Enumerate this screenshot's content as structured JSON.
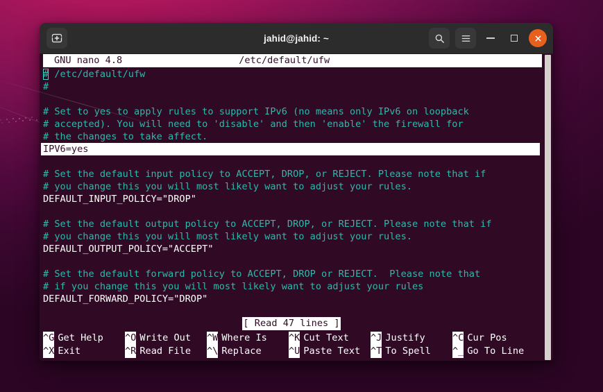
{
  "window": {
    "title": "jahid@jahid: ~",
    "new_tab_icon": "new-terminal-icon",
    "search_icon": "search-icon",
    "menu_icon": "hamburger-menu-icon",
    "minimize_label": "—",
    "maximize_label": "□",
    "close_label": "✕",
    "accent_close_color": "#e8601d",
    "titlebar_color": "#2c2c2c"
  },
  "terminal": {
    "background_color": "#300a24",
    "foreground_color": "#ffffff",
    "comment_color": "#2fb8ab"
  },
  "nano": {
    "version": "GNU nano 4.8",
    "filename": "/etc/default/ufw",
    "status_message": "[ Read 47 lines ]",
    "lines": [
      {
        "type": "comment-cursor",
        "cursor": "#",
        "rest": " /etc/default/ufw"
      },
      {
        "type": "comment",
        "text": "#"
      },
      {
        "type": "blank",
        "text": ""
      },
      {
        "type": "comment",
        "text": "# Set to yes to apply rules to support IPv6 (no means only IPv6 on loopback"
      },
      {
        "type": "comment",
        "text": "# accepted). You will need to 'disable' and then 'enable' the firewall for"
      },
      {
        "type": "comment",
        "text": "# the changes to take affect."
      },
      {
        "type": "selected",
        "text": "IPV6=yes"
      },
      {
        "type": "blank",
        "text": ""
      },
      {
        "type": "comment",
        "text": "# Set the default input policy to ACCEPT, DROP, or REJECT. Please note that if"
      },
      {
        "type": "comment",
        "text": "# you change this you will most likely want to adjust your rules."
      },
      {
        "type": "text",
        "text": "DEFAULT_INPUT_POLICY=\"DROP\""
      },
      {
        "type": "blank",
        "text": ""
      },
      {
        "type": "comment",
        "text": "# Set the default output policy to ACCEPT, DROP, or REJECT. Please note that if"
      },
      {
        "type": "comment",
        "text": "# you change this you will most likely want to adjust your rules."
      },
      {
        "type": "text",
        "text": "DEFAULT_OUTPUT_POLICY=\"ACCEPT\""
      },
      {
        "type": "blank",
        "text": ""
      },
      {
        "type": "comment",
        "text": "# Set the default forward policy to ACCEPT, DROP or REJECT.  Please note that"
      },
      {
        "type": "comment",
        "text": "# if you change this you will most likely want to adjust your rules"
      },
      {
        "type": "text",
        "text": "DEFAULT_FORWARD_POLICY=\"DROP\""
      },
      {
        "type": "blank",
        "text": ""
      },
      {
        "type": "blank",
        "text": ""
      }
    ],
    "shortcuts_row1": [
      {
        "key": "^G",
        "label": "Get Help"
      },
      {
        "key": "^O",
        "label": "Write Out"
      },
      {
        "key": "^W",
        "label": "Where Is"
      },
      {
        "key": "^K",
        "label": "Cut Text"
      },
      {
        "key": "^J",
        "label": "Justify"
      },
      {
        "key": "^C",
        "label": "Cur Pos"
      }
    ],
    "shortcuts_row2": [
      {
        "key": "^X",
        "label": "Exit"
      },
      {
        "key": "^R",
        "label": "Read File"
      },
      {
        "key": "^\\",
        "label": "Replace"
      },
      {
        "key": "^U",
        "label": "Paste Text"
      },
      {
        "key": "^T",
        "label": "To Spell"
      },
      {
        "key": "^_",
        "label": "Go To Line"
      }
    ]
  }
}
